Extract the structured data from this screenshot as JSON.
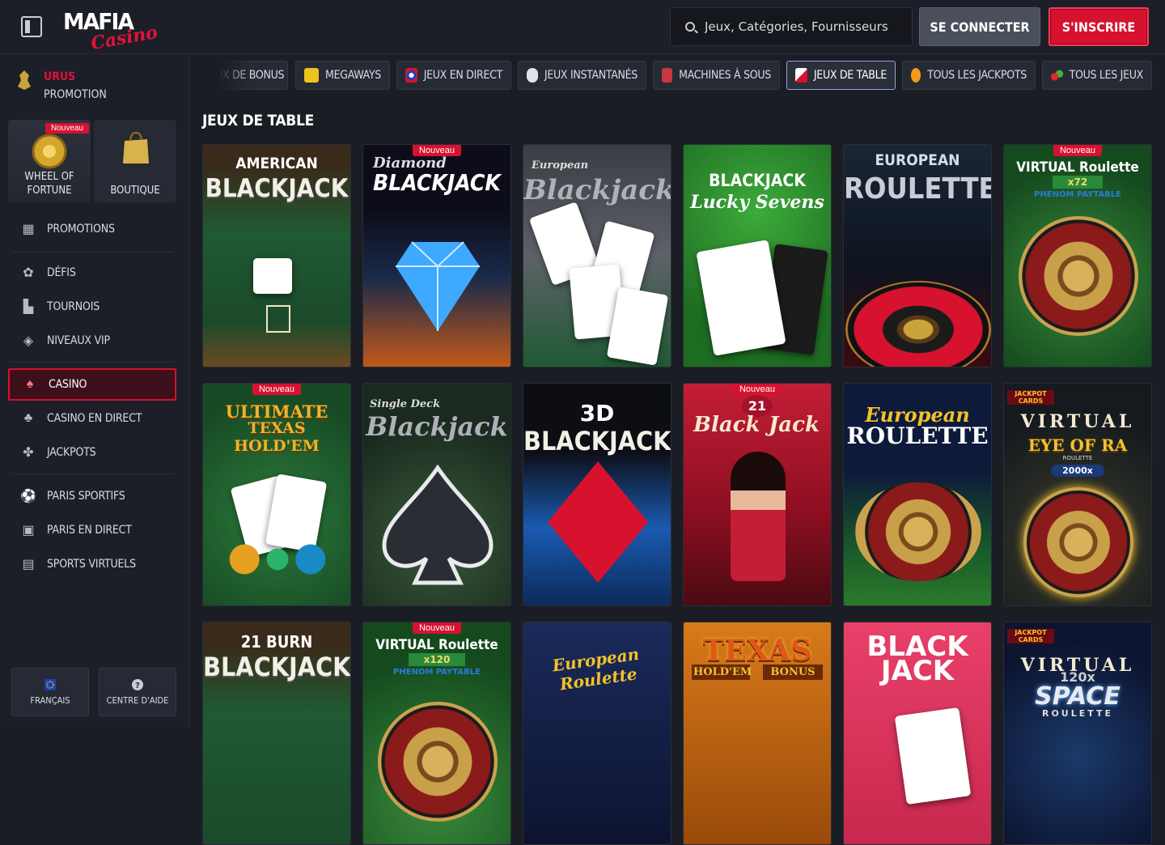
{
  "header": {
    "logo_main": "MAFIA",
    "logo_sub": "Casino",
    "search_placeholder": "Jeux, Catégories, Fournisseurs",
    "login_label": "SE CONNECTER",
    "signup_label": "S'INSCRIRE"
  },
  "sidebar": {
    "promo_title": "URUS",
    "promo_sub": "PROMOTION",
    "tiles": [
      {
        "label": "WHEEL OF FORTUNE",
        "badge": "Nouveau"
      },
      {
        "label": "BOUTIQUE"
      }
    ],
    "items": [
      {
        "label": "PROMOTIONS",
        "icon": "gift-icon"
      },
      {
        "label": "DÉFIS",
        "icon": "gear-icon"
      },
      {
        "label": "TOURNOIS",
        "icon": "podium-icon"
      },
      {
        "label": "NIVEAUX VIP",
        "icon": "diamond-icon"
      },
      {
        "label": "CASINO",
        "icon": "chips-icon"
      },
      {
        "label": "CASINO EN DIRECT",
        "icon": "live-casino-icon"
      },
      {
        "label": "JACKPOTS",
        "icon": "clover-icon"
      },
      {
        "label": "PARIS SPORTIFS",
        "icon": "football-icon"
      },
      {
        "label": "PARIS EN DIRECT",
        "icon": "live-icon"
      },
      {
        "label": "SPORTS VIRTUELS",
        "icon": "virtual-sports-icon"
      }
    ],
    "footer": {
      "language": "FRANÇAIS",
      "help": "CENTRE D'AIDE"
    }
  },
  "categories": [
    {
      "label": "JEUX DE BONUS",
      "visible_label": "TS DE BONUS"
    },
    {
      "label": "MEGAWAYS"
    },
    {
      "label": "JEUX EN DIRECT"
    },
    {
      "label": "JEUX INSTANTANÉS"
    },
    {
      "label": "MACHINES À SOUS"
    },
    {
      "label": "JEUX DE TABLE"
    },
    {
      "label": "TOUS LES JACKPOTS"
    },
    {
      "label": "TOUS LES JEUX"
    }
  ],
  "section_title": "JEUX DE TABLE",
  "badge_new": "Nouveau",
  "games": [
    {
      "t1": "AMERICAN",
      "t2": "BLACKJACK"
    },
    {
      "t1": "Diamond",
      "t2": "BLACKJACK"
    },
    {
      "t1": "European",
      "t2": "Blackjack"
    },
    {
      "t1": "BLACKJACK",
      "t2": "Lucky Sevens"
    },
    {
      "t1": "EUROPEAN",
      "t2": "ROULETTE"
    },
    {
      "t1": "VIRTUAL Roulette",
      "t2": "x72",
      "t3": "PHENOM PAYTABLE"
    },
    {
      "t1": "ULTIMATE",
      "t2": "TEXAS HOLD'EM"
    },
    {
      "t1": "Single Deck",
      "t2": "Blackjack"
    },
    {
      "t1": "3D",
      "t2": "BLACKJACK"
    },
    {
      "t1": "Black",
      "t2": "Jack",
      "t3": "21"
    },
    {
      "t1": "European",
      "t2": "ROULETTE"
    },
    {
      "t1": "VIRTUAL",
      "t2": "EYE OF RA",
      "t3": "ROULETTE",
      "t4": "2000x",
      "t5": "JACKPOT CARDS"
    },
    {
      "t1": "21 BURN",
      "t2": "BLACKJACK"
    },
    {
      "t1": "VIRTUAL Roulette",
      "t2": "x120",
      "t3": "PHENOM PAYTABLE"
    },
    {
      "t1": "European Roulette"
    },
    {
      "t1": "TEXAS",
      "t2": "HOLD'EM",
      "t3": "BONUS"
    },
    {
      "t1": "BLACK",
      "t2": "JACK"
    },
    {
      "t1": "VIRTUAL",
      "t2": "SPACE",
      "t3": "ROULETTE",
      "t4": "120x",
      "t5": "JACKPOT CARDS"
    }
  ]
}
